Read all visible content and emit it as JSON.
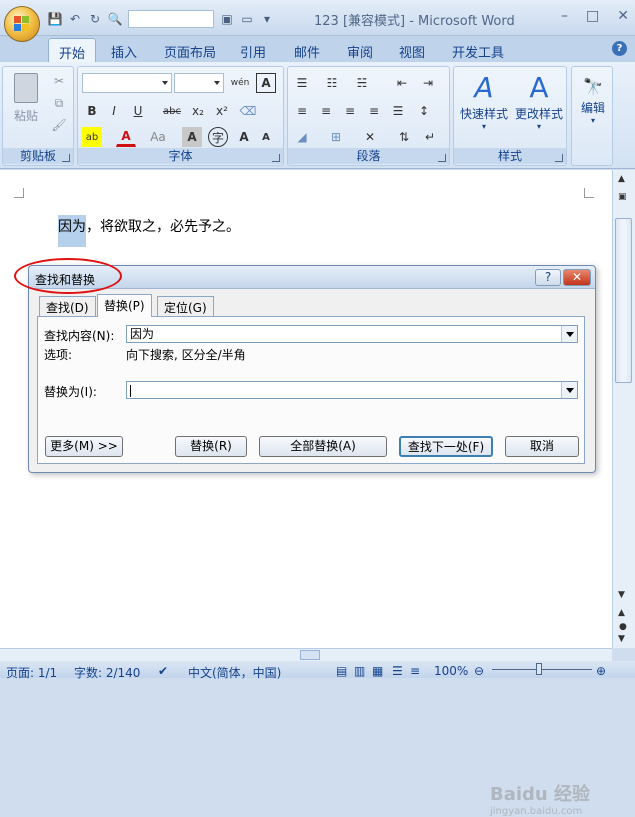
{
  "window": {
    "title": "123 [兼容模式] - Microsoft Word"
  },
  "tabs": [
    "开始",
    "插入",
    "页面布局",
    "引用",
    "邮件",
    "审阅",
    "视图",
    "开发工具"
  ],
  "ribbon": {
    "clipboard": {
      "label": "剪贴板",
      "paste": "粘贴"
    },
    "font": {
      "label": "字体",
      "bold": "B",
      "italic": "I",
      "underline": "U",
      "strike": "abc",
      "sub": "x₂",
      "sup": "x²",
      "grow": "A",
      "shrink": "A",
      "case": "Aa",
      "charborder": "A",
      "phonetic": "A",
      "enclose": "字"
    },
    "paragraph": {
      "label": "段落"
    },
    "styles": {
      "label": "样式",
      "quick": "快速样式",
      "change": "更改样式"
    },
    "editing": {
      "label": "编辑"
    }
  },
  "document": {
    "selected": "因为",
    "rest": "，将欲取之，必先予之。"
  },
  "dialog": {
    "title": "查找和替换",
    "tabs": {
      "find": "查找(D)",
      "replace": "替换(P)",
      "goto": "定位(G)"
    },
    "find_label": "查找内容(N):",
    "find_value": "因为",
    "options_label": "选项:",
    "options_value": "向下搜索, 区分全/半角",
    "replace_label": "替换为(I):",
    "replace_value": "",
    "buttons": {
      "more": "更多(M) >>",
      "replace": "替换(R)",
      "replace_all": "全部替换(A)",
      "find_next": "查找下一处(F)",
      "cancel": "取消"
    }
  },
  "status": {
    "page": "页面: 1/1",
    "words": "字数: 2/140",
    "lang": "中文(简体，中国)",
    "zoom": "100%"
  },
  "watermark": "Baidu 经验",
  "watermark_url": "jingyan.baidu.com"
}
